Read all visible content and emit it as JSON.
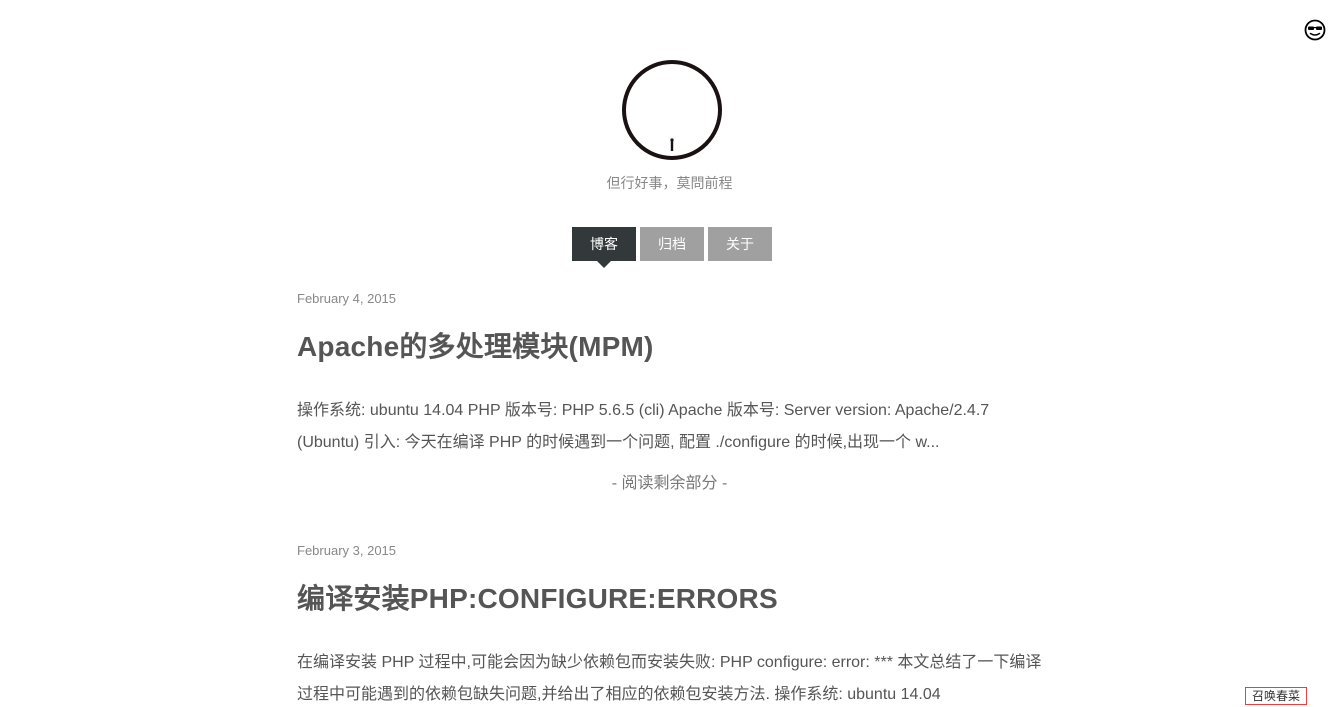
{
  "header": {
    "tagline": "但行好事，莫問前程"
  },
  "nav": {
    "tabs": [
      {
        "label": "博客",
        "active": true
      },
      {
        "label": "归档",
        "active": false
      },
      {
        "label": "关于",
        "active": false
      }
    ]
  },
  "posts": [
    {
      "date": "February 4, 2015",
      "title": "Apache的多处理模块(MPM)",
      "excerpt": "操作系统: ubuntu 14.04 PHP 版本号: PHP 5.6.5 (cli) Apache 版本号: Server version: Apache/2.4.7 (Ubuntu) 引入: 今天在编译 PHP 的时候遇到一个问题, 配置 ./configure 的时候,出现一个 w...",
      "read_more": "- 阅读剩余部分 -"
    },
    {
      "date": "February 3, 2015",
      "title": "编译安装PHP:CONFIGURE:ERRORS",
      "excerpt": "在编译安装 PHP 过程中,可能会因为缺少依赖包而安装失败: PHP configure: error: *** 本文总结了一下编译过程中可能遇到的依赖包缺失问题,并给出了相应的依赖包安装方法. 操作系统: ubuntu 14.04"
    }
  ],
  "corner_link": {
    "label": "召唤春菜"
  },
  "icons": {
    "corner_icon": "sunglasses-face-icon",
    "logo": "circle-figure-logo"
  }
}
